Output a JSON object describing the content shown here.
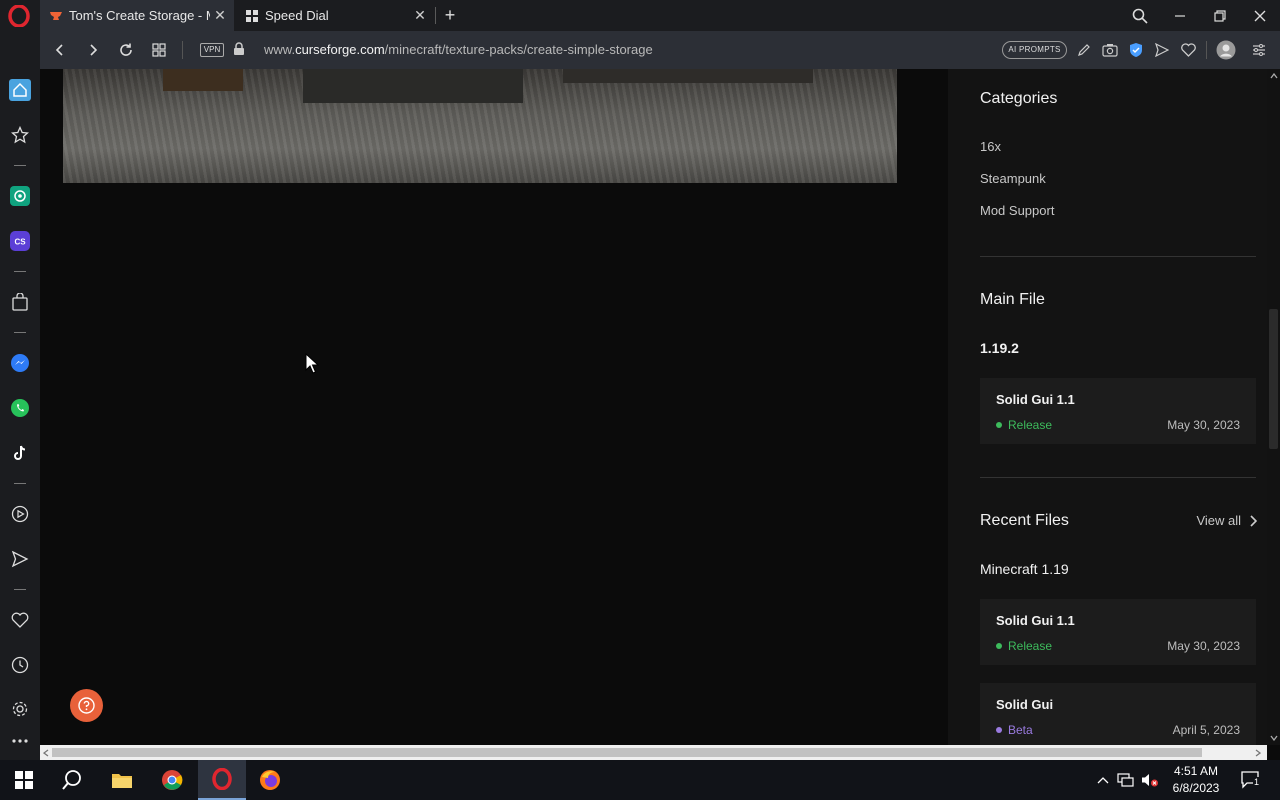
{
  "browser": {
    "tabs": [
      {
        "title": "Tom's Create Storage - Mir",
        "active": true
      },
      {
        "title": "Speed Dial",
        "active": false
      }
    ],
    "url": {
      "prefix": "www.",
      "domain": "curseforge.com",
      "path": "/minecraft/texture-packs/create-simple-storage"
    },
    "vpn_label": "VPN",
    "ai_prompts_label": "AI PROMPTS"
  },
  "sidebar": {
    "icons": [
      "home-icon",
      "star-icon",
      "chatgpt-icon",
      "cs-icon",
      "shopping-bag-icon",
      "messenger-icon",
      "whatsapp-icon",
      "tiktok-icon",
      "player-icon",
      "send-icon",
      "heart-icon",
      "history-icon",
      "settings-icon",
      "more-icon"
    ],
    "cs_label": "CS"
  },
  "right_panel": {
    "categories_title": "Categories",
    "categories": [
      "16x",
      "Steampunk",
      "Mod Support"
    ],
    "main_file": {
      "title": "Main File",
      "version": "1.19.2",
      "file": {
        "name": "Solid Gui 1.1",
        "type": "Release",
        "date": "May 30, 2023"
      }
    },
    "recent_files": {
      "title": "Recent Files",
      "view_all": "View all",
      "group": "Minecraft 1.19",
      "files": [
        {
          "name": "Solid Gui 1.1",
          "type": "Release",
          "date": "May 30, 2023"
        },
        {
          "name": "Solid Gui",
          "type": "Beta",
          "date": "April 5, 2023"
        }
      ]
    }
  },
  "colors": {
    "release": "#3dbb5c",
    "beta": "#9a7be0",
    "accent": "#e8613a"
  },
  "taskbar": {
    "time": "4:51 AM",
    "date": "6/8/2023",
    "notification_count": "1"
  }
}
